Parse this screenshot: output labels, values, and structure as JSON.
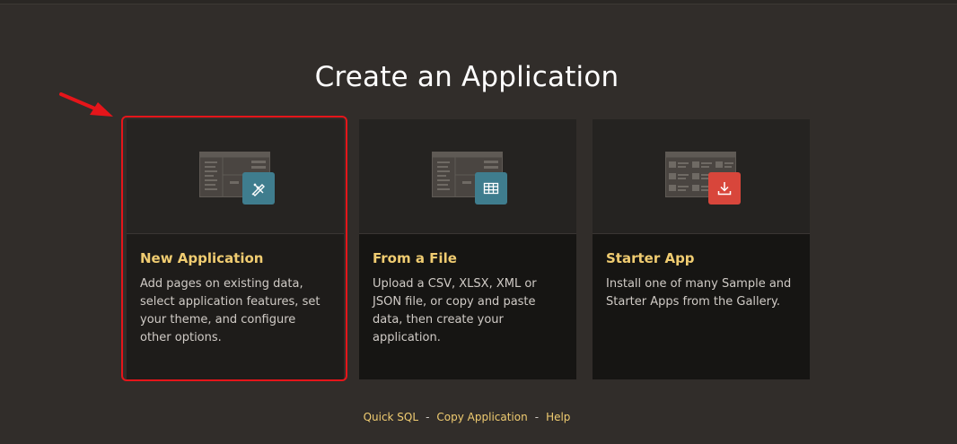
{
  "page": {
    "title": "Create an Application"
  },
  "cards": [
    {
      "title": "New Application",
      "description": "Add pages on existing data, select application features, set your theme, and configure other options.",
      "icon": "pencil-ruler-icon",
      "badge_color": "#3f7d8e"
    },
    {
      "title": "From a File",
      "description": "Upload a CSV, XLSX, XML or JSON file, or copy and paste data, then create your application.",
      "icon": "table-grid-icon",
      "badge_color": "#3f7d8e"
    },
    {
      "title": "Starter App",
      "description": "Install one of many Sample and Starter Apps from the Gallery.",
      "icon": "download-icon",
      "badge_color": "#d8463b"
    }
  ],
  "footer": {
    "links": [
      "Quick SQL",
      "Copy Application",
      "Help"
    ],
    "separator": "-"
  },
  "colors": {
    "background": "#312d2a",
    "accent": "#f0cc71",
    "highlight": "#e5151a"
  }
}
